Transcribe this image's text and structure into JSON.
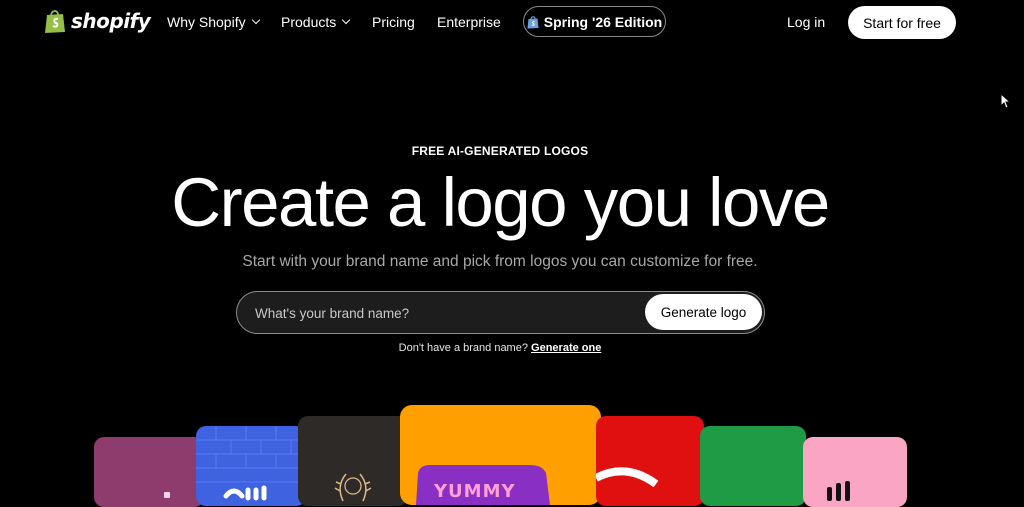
{
  "nav": {
    "logo_text": "shopify",
    "items": [
      {
        "label": "Why Shopify",
        "has_dropdown": true
      },
      {
        "label": "Products",
        "has_dropdown": true
      },
      {
        "label": "Pricing",
        "has_dropdown": false
      },
      {
        "label": "Enterprise",
        "has_dropdown": false
      }
    ],
    "edition_label": "Spring '26 Edition",
    "login_label": "Log in",
    "start_label": "Start for free"
  },
  "hero": {
    "eyebrow": "FREE AI-GENERATED LOGOS",
    "headline": "Create a logo you love",
    "subtitle": "Start with your brand name and pick from logos you can customize for free.",
    "input_placeholder": "What's your brand name?",
    "input_value": "",
    "generate_label": "Generate logo",
    "no_brand_text": "Don't have a brand name?",
    "no_brand_link": "Generate one"
  },
  "showcase": {
    "cards": [
      {
        "name": "card-mauve",
        "color": "#8e3c6e"
      },
      {
        "name": "card-blue-brick",
        "color": "#3f62e0"
      },
      {
        "name": "card-dark-wreath",
        "color": "#2e2a28"
      },
      {
        "name": "card-orange-yummy",
        "color": "#ff9f00",
        "accent": "#8a2fc4"
      },
      {
        "name": "card-red",
        "color": "#e01010"
      },
      {
        "name": "card-green",
        "color": "#1f9a45"
      },
      {
        "name": "card-pink",
        "color": "#fba5c4"
      }
    ]
  },
  "colors": {
    "background": "#000000",
    "brand_green": "#95bf47",
    "text": "#ffffff"
  }
}
